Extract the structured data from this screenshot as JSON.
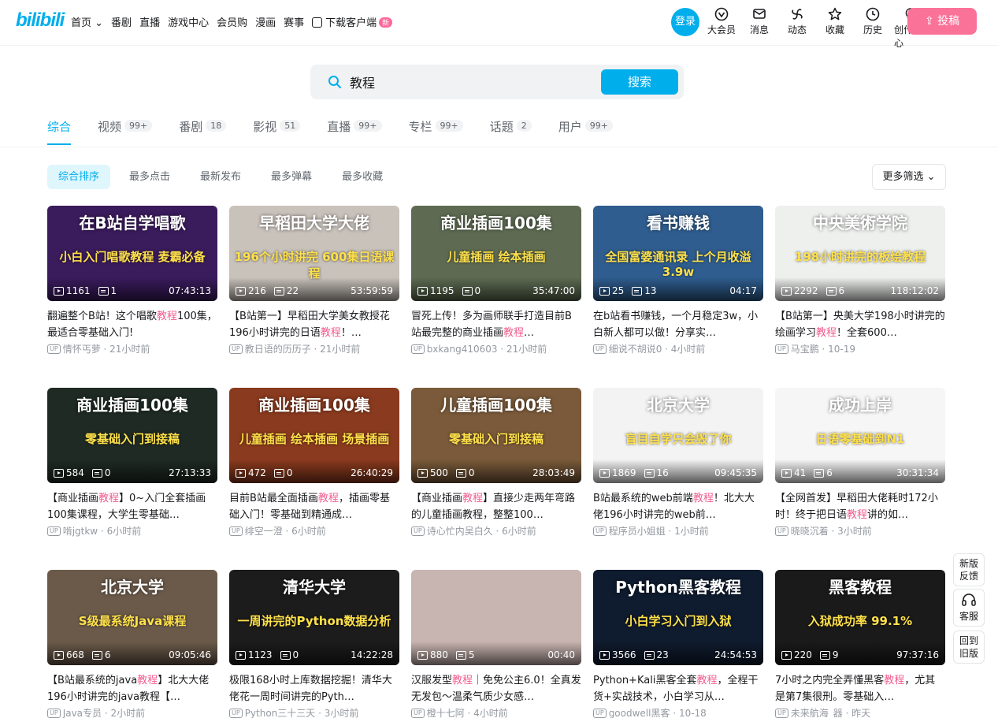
{
  "header": {
    "logo": "bilibili",
    "nav": [
      "首页",
      "番剧",
      "直播",
      "游戏中心",
      "会员购",
      "漫画",
      "赛事",
      "下载客户端"
    ],
    "nav_new_badge": "新",
    "login": "登录",
    "icons": [
      {
        "label": "大会员",
        "icon": "vip-icon"
      },
      {
        "label": "消息",
        "icon": "message-icon"
      },
      {
        "label": "动态",
        "icon": "dynamic-icon"
      },
      {
        "label": "收藏",
        "icon": "star-icon"
      },
      {
        "label": "历史",
        "icon": "clock-icon"
      },
      {
        "label": "创作中心",
        "icon": "bulb-icon"
      }
    ],
    "upload": "投稿"
  },
  "search": {
    "value": "教程",
    "button": "搜索"
  },
  "tabs": [
    {
      "label": "综合",
      "count": ""
    },
    {
      "label": "视频",
      "count": "99+"
    },
    {
      "label": "番剧",
      "count": "18"
    },
    {
      "label": "影视",
      "count": "51"
    },
    {
      "label": "直播",
      "count": "99+"
    },
    {
      "label": "专栏",
      "count": "99+"
    },
    {
      "label": "话题",
      "count": "2"
    },
    {
      "label": "用户",
      "count": "99+"
    }
  ],
  "filters": [
    "综合排序",
    "最多点击",
    "最新发布",
    "最多弹幕",
    "最多收藏"
  ],
  "more_filter": "更多筛选",
  "videos": [
    {
      "cover": "在B站自学唱歌",
      "sub": "小白入门唱歌教程 麦霸必备",
      "bg": "#3a1b5c",
      "plays": "1161",
      "danmaku": "1",
      "duration": "07:43:13",
      "t1": "翻遍整个B站！这个唱歌",
      "kw": "教程",
      "t2": "100集，最适合零基础入门!",
      "up": "情怀丐萝",
      "time": "21小时前"
    },
    {
      "cover": "早稻田大学大佬",
      "sub": "196个小时讲完 600集日语课程",
      "bg": "#c9c2bb",
      "plays": "216",
      "danmaku": "22",
      "duration": "53:59:59",
      "t1": "【B站第一】早稻田大学美女教授花196小时讲完的日语",
      "kw": "教程",
      "t2": "！…",
      "up": "教日语的历历子",
      "time": "21小时前"
    },
    {
      "cover": "商业插画100集",
      "sub": "儿童插画 绘本插画",
      "bg": "#5e6b52",
      "plays": "1195",
      "danmaku": "0",
      "duration": "35:47:00",
      "t1": "冒死上传！多为画师联手打造目前B站最完整的商业插画",
      "kw": "教程",
      "t2": "…",
      "up": "bxkang410603",
      "time": "21小时前"
    },
    {
      "cover": "看书赚钱",
      "sub": "全国富婆通讯录 上个月收溢3.9w",
      "bg": "#2f5d8f",
      "plays": "25",
      "danmaku": "13",
      "duration": "04:17",
      "t1": "在b站看书赚钱，一个月稳定3w，小白新人都可以做！分享实…",
      "kw": "",
      "t2": "",
      "up": "细说不胡说0",
      "time": "4小时前"
    },
    {
      "cover": "中央美術学院",
      "sub": "198小时讲完的板绘教程",
      "bg": "#eef0ee",
      "plays": "2292",
      "danmaku": "6",
      "duration": "118:12:02",
      "t1": "【B站第一】央美大学198小时讲完的绘画学习",
      "kw": "教程",
      "t2": "！全套600…",
      "up": "马宝鹏",
      "time": "10-19"
    },
    {
      "cover": "商业插画100集",
      "sub": "零基础入门到接稿",
      "bg": "#1f2a24",
      "plays": "584",
      "danmaku": "0",
      "duration": "27:13:33",
      "t1": "【商业插画",
      "kw": "教程",
      "t2": "】0~入门全套插画100集课程，大学生零基础…",
      "up": "啃jgtkw",
      "time": "6小时前"
    },
    {
      "cover": "商业插画100集",
      "sub": "儿童插画 绘本插画 场景插画",
      "bg": "#8a3a1e",
      "plays": "472",
      "danmaku": "0",
      "duration": "26:40:29",
      "t1": "目前B站最全面插画",
      "kw": "教程",
      "t2": "，插画零基础入门！零基础到精通成…",
      "up": "绯空一澄",
      "time": "6小时前"
    },
    {
      "cover": "儿童插画100集",
      "sub": "零基础入门到接稿",
      "bg": "#7a5a3a",
      "plays": "500",
      "danmaku": "0",
      "duration": "28:03:49",
      "t1": "【商业插画",
      "kw": "教程",
      "t2": "】直接少走两年弯路的儿童插画教程，整整100…",
      "up": "诗心忙内吴白久",
      "time": "6小时前"
    },
    {
      "cover": "北京大学",
      "sub": "盲目自学只会毁了你",
      "bg": "#f3f3f3",
      "plays": "1869",
      "danmaku": "16",
      "duration": "09:45:35",
      "t1": "B站最系统的web前端",
      "kw": "教程",
      "t2": "！北大大佬196小时讲完的web前…",
      "up": "程序员小姐姐",
      "time": "1小时前"
    },
    {
      "cover": "成功上岸",
      "sub": "日语零基础到N1",
      "bg": "#f6f6f6",
      "plays": "41",
      "danmaku": "6",
      "duration": "30:31:34",
      "t1": "【全网首发】早稻田大佬耗时172小时！终于把日语",
      "kw": "教程",
      "t2": "讲的如…",
      "up": "晓晓沉着",
      "time": "3小时前"
    },
    {
      "cover": "北京大学",
      "sub": "S级最系统Java课程",
      "bg": "#6b5a4a",
      "plays": "668",
      "danmaku": "6",
      "duration": "09:05:46",
      "t1": "【B站最系统的java",
      "kw": "教程",
      "t2": "】北大大佬196小时讲完的java教程【…",
      "up": "Java专员",
      "time": "2小时前"
    },
    {
      "cover": "清华大学",
      "sub": "一周讲完的Python数据分析",
      "bg": "#1c1c1c",
      "plays": "1123",
      "danmaku": "0",
      "duration": "14:22:28",
      "t1": "极限168小时上库数据挖掘！清华大佬花一周时间讲完的Pyth…",
      "kw": "",
      "t2": "",
      "up": "Python三十三天",
      "time": "3小时前"
    },
    {
      "cover": "",
      "sub": "",
      "bg": "#c8b4b0",
      "plays": "880",
      "danmaku": "5",
      "duration": "00:40",
      "t1": "汉服发型",
      "kw": "教程",
      "t2": "｜免免公主6.0！全真发无发包～温柔气质少女感…",
      "up": "橙十七阿",
      "time": "4小时前"
    },
    {
      "cover": "Python黑客教程",
      "sub": "小白学习入门到入狱",
      "bg": "#0f1b2e",
      "plays": "3566",
      "danmaku": "23",
      "duration": "24:54:53",
      "t1": "Python+Kali黑客全套",
      "kw": "教程",
      "t2": "，全程干货+实战技术，小白学习从…",
      "up": "goodwell黑客",
      "time": "10-18"
    },
    {
      "cover": "黑客教程",
      "sub": "入狱成功率 99.1%",
      "bg": "#1a1a1a",
      "plays": "220",
      "danmaku": "9",
      "duration": "97:37:16",
      "t1": "7小时之内完全弄懂黑客",
      "kw": "教程",
      "t2": "，尤其是第7集很刑。零基础入…",
      "up": "未来航海_器",
      "time": "昨天"
    }
  ],
  "side": {
    "feedback": "新版反馈",
    "service": "客服",
    "back": "回到旧版"
  }
}
